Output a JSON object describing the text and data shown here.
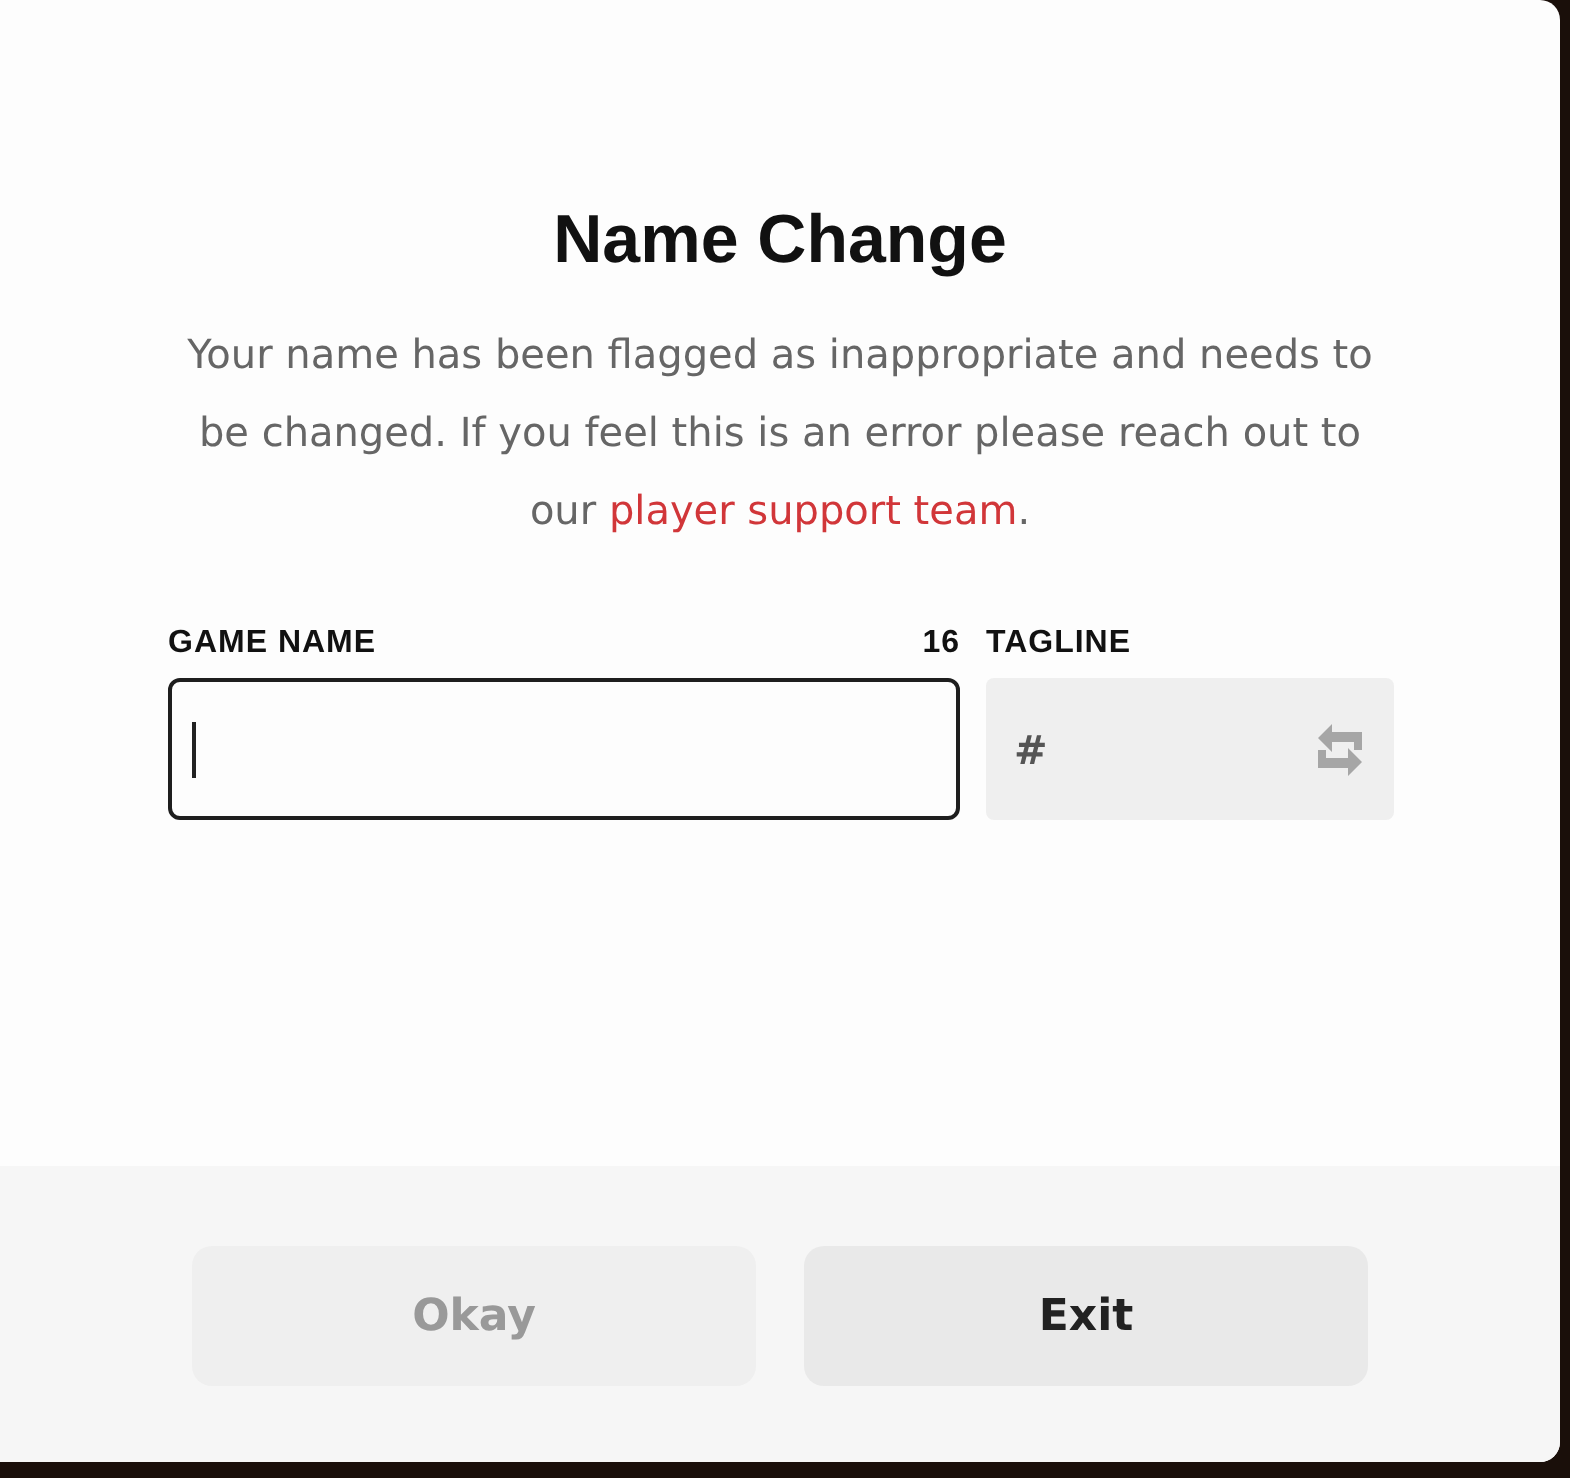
{
  "dialog": {
    "title": "Name Change",
    "message": {
      "text": "Your name has been flagged as inappropriate and needs to be changed. If you feel this is an error please reach out to our",
      "link": "player support team",
      "end": "."
    },
    "game_name": {
      "label": "GAME NAME",
      "counter": "16",
      "focused": true
    },
    "tagline": {
      "label": "TAGLINE",
      "prefix": "#"
    },
    "buttons": [
      {
        "label": "Okay",
        "disabled": true
      },
      {
        "label": "Exit",
        "disabled": false
      }
    ]
  }
}
